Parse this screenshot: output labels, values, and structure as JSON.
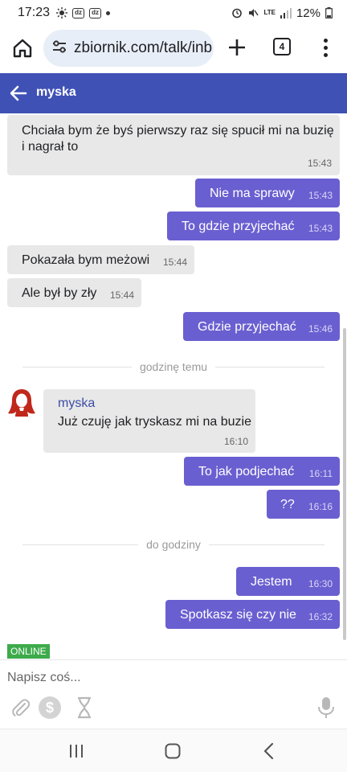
{
  "status_bar": {
    "time": "17:23",
    "badge1": "dz",
    "badge2": "dz",
    "network": "LTE",
    "battery": "12%",
    "icons": [
      "sun-icon",
      "alarm-icon",
      "mute-icon",
      "signal-icon",
      "battery-icon"
    ]
  },
  "browser": {
    "url": "zbiornik.com/talk/inb",
    "tab_count": "4"
  },
  "chat": {
    "contact_name": "myska",
    "messages": [
      {
        "dir": "in",
        "text_line1": "Chciała bym że byś pierwszy raz się spucił mi na buzię",
        "text_line2": "i nagrał to",
        "time": "15:43"
      },
      {
        "dir": "out",
        "text": "Nie ma sprawy",
        "time": "15:43"
      },
      {
        "dir": "out",
        "text": "To gdzie przyjechać",
        "time": "15:43"
      },
      {
        "dir": "in",
        "text": "Pokazała bym meżowi",
        "time": "15:44"
      },
      {
        "dir": "in",
        "text": "Ale był by zły",
        "time": "15:44"
      },
      {
        "dir": "out",
        "text": "Gdzie przyjechać",
        "time": "15:46"
      },
      {
        "dir": "in",
        "sender": "myska",
        "text": "Już czuję jak tryskasz mi na buzie",
        "time": "16:10"
      },
      {
        "dir": "out",
        "text": "To jak podjechać",
        "time": "16:11"
      },
      {
        "dir": "out",
        "text": "??",
        "time": "16:16"
      },
      {
        "dir": "out",
        "text": "Jestem",
        "time": "16:30"
      },
      {
        "dir": "out",
        "text": "Spotkasz się czy nie",
        "time": "16:32"
      }
    ],
    "dividers": [
      "godzinę temu",
      "do godziny"
    ],
    "online_label": "ONLINE",
    "input_placeholder": "Napisz coś..."
  },
  "colors": {
    "header": "#3f51b5",
    "outgoing_bubble": "#6a5fd0",
    "incoming_bubble": "#e8e8e8",
    "online": "#3dab4b",
    "avatar": "#c0281c"
  }
}
